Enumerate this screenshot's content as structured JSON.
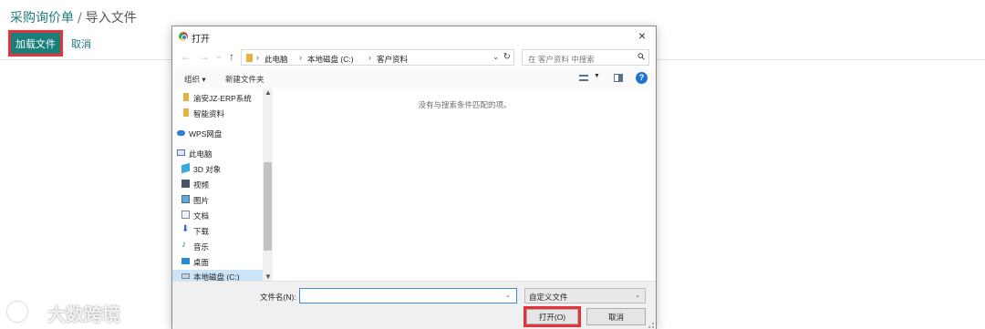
{
  "app": {
    "breadcrumb": {
      "parent": "采购询价单",
      "separator": "/",
      "current": "导入文件"
    },
    "load_button": "加载文件",
    "cancel_link": "取消"
  },
  "dialog": {
    "title": "打开",
    "close_glyph": "×",
    "nav": {
      "back": "←",
      "forward": "→",
      "recent": "⌄",
      "up": "↑"
    },
    "address": {
      "separator": "›",
      "segments": [
        "此电脑",
        "本地磁盘 (C:)",
        "客户资料"
      ]
    },
    "search_placeholder": "在 客户资料 中搜索",
    "toolbar": {
      "organize": "组织 ▾",
      "new_folder": "新建文件夹",
      "help": "?"
    },
    "nav_pane": [
      {
        "label": "渝安JZ-ERP系统",
        "icon": "folder-icon"
      },
      {
        "label": "智能资料",
        "icon": "folder-icon"
      },
      {
        "label": "WPS网盘",
        "icon": "cloud-icon"
      },
      {
        "label": "此电脑",
        "icon": "computer-icon"
      },
      {
        "label": "3D 对象",
        "icon": "cube-3d-icon"
      },
      {
        "label": "视频",
        "icon": "video-icon"
      },
      {
        "label": "图片",
        "icon": "picture-icon"
      },
      {
        "label": "文档",
        "icon": "document-icon"
      },
      {
        "label": "下载",
        "icon": "download-icon"
      },
      {
        "label": "音乐",
        "icon": "music-icon"
      },
      {
        "label": "桌面",
        "icon": "desktop-icon"
      },
      {
        "label": "本地磁盘 (C:)",
        "icon": "drive-icon",
        "selected": true
      }
    ],
    "empty_message": "没有与搜索条件匹配的项。",
    "filename_label": "文件名(N):",
    "filename_value": "",
    "filetype_value": "自定义文件",
    "open_button": "打开(O)",
    "cancel_button": "取消"
  },
  "watermark": "大数跨境",
  "colors": {
    "accent": "#1a7f7a",
    "highlight": "#e5333a",
    "selection": "#cce4f7"
  }
}
